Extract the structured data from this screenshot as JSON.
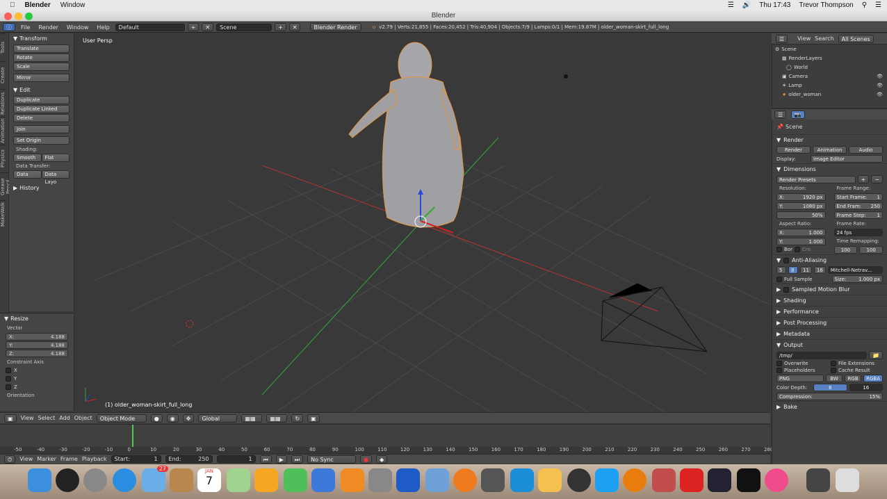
{
  "macbar": {
    "app": "Blender",
    "menu": "Window",
    "clock": "Thu 17:43",
    "user": "Trevor Thompson"
  },
  "window": {
    "title": "Blender"
  },
  "infobar": {
    "menus": [
      "File",
      "Render",
      "Window",
      "Help"
    ],
    "layout": "Default",
    "scene": "Scene",
    "engine": "Blender Render",
    "stats": "v2.79 | Verts:21,855 | Faces:20,452 | Tris:40,904 | Objects:7/9 | Lamps:0/1 | Mem:19.87M | older_woman-skirt_full_long"
  },
  "lefttabs": [
    "Tools",
    "Create",
    "Relations",
    "Animation",
    "Physics",
    "Grease Pencil",
    "MakeWalk"
  ],
  "toolshelf": {
    "transform_title": "Transform",
    "translate": "Translate",
    "rotate": "Rotate",
    "scale": "Scale",
    "mirror": "Mirror",
    "edit_title": "Edit",
    "duplicate": "Duplicate",
    "duplicate_linked": "Duplicate Linked",
    "delete": "Delete",
    "join": "Join",
    "set_origin": "Set Origin",
    "shading_label": "Shading:",
    "smooth": "Smooth",
    "flat": "Flat",
    "data_transfer_label": "Data Transfer:",
    "data": "Data",
    "data_layout": "Data Layo",
    "history": "History"
  },
  "redo": {
    "title": "Resize",
    "vector": "Vector",
    "x_label": "X:",
    "x": "4.188",
    "y_label": "Y:",
    "y": "4.188",
    "z_label": "Z:",
    "z": "4.188",
    "constraint": "Constraint Axis",
    "cx": "X",
    "cy": "Y",
    "cz": "Z",
    "orientation": "Orientation"
  },
  "viewport": {
    "label": "User Persp",
    "object_label": "(1) older_woman-skirt_full_long"
  },
  "vpheader": {
    "view": "View",
    "select": "Select",
    "add": "Add",
    "object": "Object",
    "mode": "Object Mode",
    "orientation": "Global"
  },
  "timeline": {
    "ticks": [
      "-50",
      "-40",
      "-30",
      "-20",
      "-10",
      "0",
      "10",
      "20",
      "30",
      "40",
      "50",
      "60",
      "70",
      "80",
      "90",
      "100",
      "110",
      "120",
      "130",
      "140",
      "150",
      "160",
      "170",
      "180",
      "190",
      "200",
      "210",
      "220",
      "230",
      "240",
      "250",
      "260",
      "270",
      "280"
    ]
  },
  "tlheader": {
    "view": "View",
    "marker": "Marker",
    "frame": "Frame",
    "playback": "Playback",
    "start": "Start:",
    "start_val": "1",
    "end": "End:",
    "end_val": "250",
    "current": "1",
    "sync": "No Sync"
  },
  "outliner": {
    "view": "View",
    "search": "Search",
    "all_scenes": "All Scenes",
    "items": [
      "Scene",
      "RenderLayers",
      "World",
      "Camera",
      "Lamp",
      "older_woman"
    ]
  },
  "props": {
    "scene": "Scene",
    "render": "Render",
    "render_btn": "Render",
    "animation_btn": "Animation",
    "audio_btn": "Audio",
    "display_label": "Display:",
    "display": "Image Editor",
    "dimensions": "Dimensions",
    "presets": "Render Presets",
    "resolution": "Resolution:",
    "res_x_label": "X:",
    "res_x": "1920 px",
    "res_y_label": "Y:",
    "res_y": "1080 px",
    "res_pct": "50%",
    "frame_range": "Frame Range:",
    "start_frame_label": "Start Frame:",
    "start_frame": "1",
    "end_frame_label": "End Fram:",
    "end_frame": "250",
    "frame_step_label": "Frame Step:",
    "frame_step": "1",
    "aspect": "Aspect Ratio:",
    "ax_label": "X:",
    "ax": "1.000",
    "ay_label": "Y:",
    "ay": "1.000",
    "frame_rate": "Frame Rate:",
    "fps": "24 fps",
    "time_remap": "Time Remapping:",
    "remap_old": "100",
    "remap_new": "100",
    "bor": "Bor",
    "cro": "Cro",
    "aa": "Anti-Aliasing",
    "aa_samples": [
      "5",
      "8",
      "11",
      "16"
    ],
    "aa_filter": "Mitchell-Netrav...",
    "full_sample": "Full Sample",
    "size_label": "Size:",
    "size": "1.000 px",
    "motion_blur": "Sampled Motion Blur",
    "shading": "Shading",
    "performance": "Performance",
    "post": "Post Processing",
    "metadata": "Metadata",
    "output": "Output",
    "path": "/tmp/",
    "overwrite": "Overwrite",
    "file_ext": "File Extensions",
    "placeholders": "Placeholders",
    "cache": "Cache Result",
    "format": "PNG",
    "bw": "BW",
    "rgb": "RGB",
    "rgba": "RGBA",
    "depth_label": "Color Depth:",
    "d8": "8",
    "d16": "16",
    "compression": "Compression:",
    "comp_val": "15%",
    "bake": "Bake"
  },
  "dock": {
    "badge_mail": "27",
    "cal_month": "JAN",
    "cal_day": "7"
  }
}
